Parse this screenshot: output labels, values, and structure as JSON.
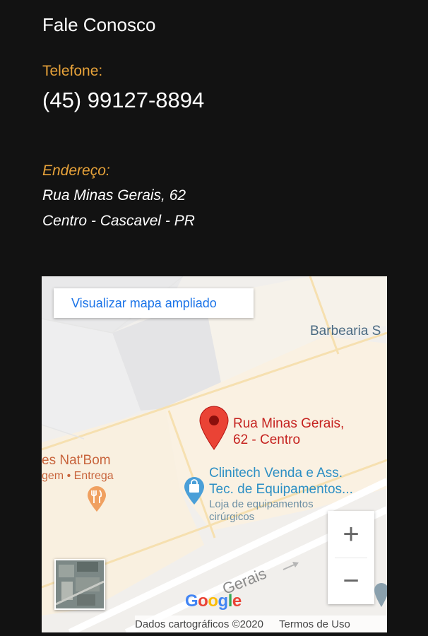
{
  "contact": {
    "title": "Fale Conosco",
    "phone_label": "Telefone:",
    "phone": "(45) 99127-8894",
    "address_label": "Endereço:",
    "address_line1": "Rua Minas Gerais, 62",
    "address_line2": "Centro - Cascavel - PR"
  },
  "map": {
    "view_larger": "Visualizar mapa ampliado",
    "place_barbearia": "Barbearia S",
    "place_natbom": "es Nat'Bom",
    "place_natbom_sub": "gem • Entrega",
    "pin_label_line1": "Rua Minas Gerais,",
    "pin_label_line2": "62 - Centro",
    "clinitech_line1": "Clinitech Venda e Ass.",
    "clinitech_line2": "Tec. de Equipamentos...",
    "clinitech_sub1": "Loja de equipamentos",
    "clinitech_sub2": "cirúrgicos",
    "street": "Gerais",
    "zoom_in": "+",
    "zoom_out": "−",
    "logo": {
      "g1": "G",
      "o1": "o",
      "o2": "o",
      "g2": "g",
      "l": "l",
      "e": "e"
    },
    "attribution": "Dados cartográficos ©2020",
    "terms": "Termos de Uso"
  },
  "colors": {
    "accent": "#e8a33a",
    "background": "#121212",
    "pin": "#ea4335",
    "link": "#1a73e8"
  },
  "icons": [
    "map-pin-icon",
    "restaurant-icon",
    "shopping-bag-icon",
    "zoom-in-icon",
    "zoom-out-icon",
    "satellite-thumbnail",
    "street-arrow-icon"
  ]
}
